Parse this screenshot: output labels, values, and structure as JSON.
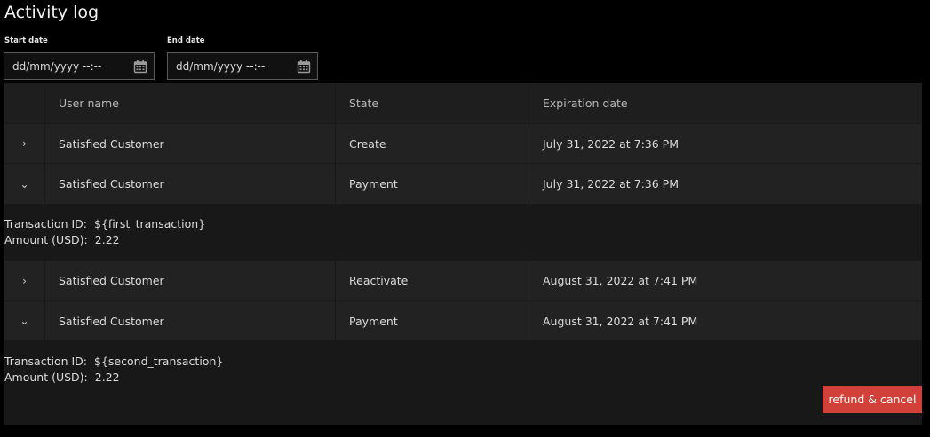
{
  "page": {
    "title": "Activity log"
  },
  "filters": {
    "start": {
      "label": "Start date",
      "placeholder": "dd/mm/yyyy --:--",
      "icon": "calendar-icon"
    },
    "end": {
      "label": "End date",
      "placeholder": "dd/mm/yyyy --:--",
      "icon": "calendar-icon"
    }
  },
  "table": {
    "headers": [
      "",
      "User name",
      "State",
      "Expiration date"
    ],
    "rows": [
      {
        "expander": "›",
        "user": "Satisfied Customer",
        "state": "Create",
        "expiration": "July 31, 2022 at 7:36 PM"
      },
      {
        "expander": "⌄",
        "user": "Satisfied Customer",
        "state": "Payment",
        "expiration": "July 31, 2022 at 7:36 PM"
      },
      {
        "expander": "›",
        "user": "Satisfied Customer",
        "state": "Reactivate",
        "expiration": "August 31, 2022 at 7:41 PM"
      },
      {
        "expander": "⌄",
        "user": "Satisfied Customer",
        "state": "Payment",
        "expiration": "August 31, 2022 at 7:41 PM"
      }
    ],
    "details": [
      {
        "transaction_label": "Transaction ID:",
        "transaction_value": "${first_transaction}",
        "amount_label": "Amount (USD):",
        "amount_value": "2.22"
      },
      {
        "transaction_label": "Transaction ID:",
        "transaction_value": "${second_transaction}",
        "amount_label": "Amount (USD):",
        "amount_value": "2.22"
      }
    ]
  },
  "actions": {
    "refund_label": "refund & cancel"
  },
  "colors": {
    "accent": "#d2403a",
    "background": "#000000",
    "row": "#222222",
    "header": "#1e1e1e"
  }
}
